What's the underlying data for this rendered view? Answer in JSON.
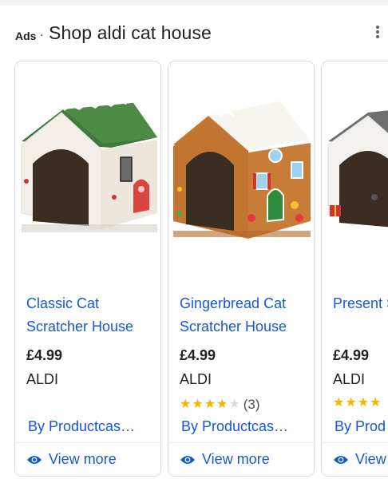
{
  "header": {
    "ads_label": "Ads",
    "separator": "·",
    "title": "Shop aldi cat house",
    "menu_icon": "more-vert-icon"
  },
  "products": [
    {
      "image_icon": "white-cat-house-with-green-roof",
      "title": "Classic Cat Scratcher House",
      "price": "£4.99",
      "store": "ALDI",
      "rating": null,
      "rating_count": null,
      "by_line": "By Productcas…",
      "view_more": "View more"
    },
    {
      "image_icon": "gingerbread-cat-house",
      "title": "Gingerbread Cat Scratcher House",
      "price": "£4.99",
      "store": "ALDI",
      "rating": 4,
      "rating_count": "(3)",
      "by_line": "By Productcas…",
      "view_more": "View more"
    },
    {
      "image_icon": "present-cat-house",
      "title": "Present Scratcher",
      "price": "£4.99",
      "store": "ALDI",
      "rating": 4,
      "rating_count": "",
      "by_line": "By Prod",
      "view_more": "View"
    }
  ],
  "colors": {
    "link": "#1558d6",
    "text": "#202124",
    "star": "#f4b400",
    "border": "#dadce0"
  }
}
